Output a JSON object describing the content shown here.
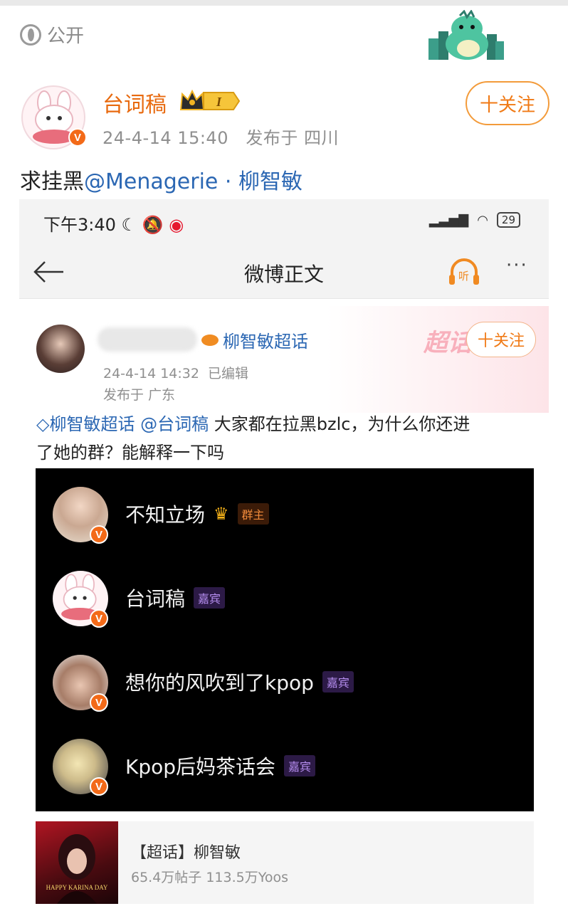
{
  "visibility": {
    "label": "公开",
    "icon": "globe-icon"
  },
  "post": {
    "author": "台词稿",
    "level_badge": "I",
    "timestamp": "24-4-14 15:40",
    "location": "发布于 四川",
    "follow_label": "十关注",
    "text_prefix": "求挂黑",
    "text_mention": "@Menagerie · 柳智敏"
  },
  "screenshot": {
    "status_time": "下午3:40",
    "battery": "29",
    "nav_title": "微博正文",
    "listen_label": "听",
    "more": "···",
    "inner_post": {
      "topic_tag": "柳智敏超话",
      "date": "24-4-14 14:32",
      "edited": "已编辑",
      "location": "发布于 广东",
      "follow_label": "十关注",
      "watermark": "超话",
      "text_topic": "柳智敏超话",
      "text_mention": "@台词稿",
      "text_line1": " 大家都在拉黑bzlc，为什么你还进",
      "text_line2": "了她的群？能解释一下吗"
    },
    "members": [
      {
        "name": "不知立场",
        "role": "群主"
      },
      {
        "name": "台词稿",
        "role": "嘉宾"
      },
      {
        "name": "想你的风吹到了kpop",
        "role": "嘉宾"
      },
      {
        "name": "Kpop后妈茶话会",
        "role": "嘉宾"
      }
    ],
    "supertopic": {
      "title": "【超话】柳智敏",
      "stats": "65.4万帖子 113.5万Yoos",
      "poster_text": "HAPPY KARINA DAY"
    }
  },
  "colors": {
    "orange": "#f07a16",
    "link_blue": "#2b67b3",
    "panel": "#000000"
  }
}
